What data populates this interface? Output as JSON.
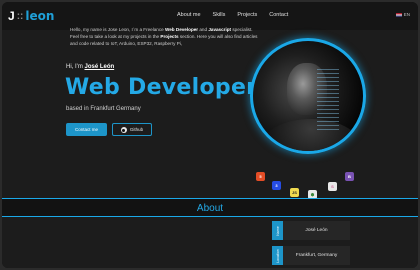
{
  "nav": {
    "logo_mark": "J",
    "logo_sep": "::",
    "logo_name": "leon",
    "links": [
      "About me",
      "Skills",
      "Projects",
      "Contact"
    ],
    "lang": "EN"
  },
  "hero": {
    "greeting_prefix": "Hi, I'm",
    "name": "José León",
    "title": "Web Developer",
    "location": "based in Frankfurt Germany",
    "contact_label": "Contact me",
    "github_label": "Github"
  },
  "tech_icons": [
    {
      "name": "html5-icon",
      "glyph": "5"
    },
    {
      "name": "css3-icon",
      "glyph": "3"
    },
    {
      "name": "javascript-icon",
      "glyph": "JS"
    },
    {
      "name": "nodejs-icon",
      "glyph": "⬢"
    },
    {
      "name": "sass-icon",
      "glyph": "S"
    },
    {
      "name": "bootstrap-icon",
      "glyph": "B"
    }
  ],
  "about": {
    "title": "About",
    "text_1": "Hello, my name is Jose Leon, I´m a Freelance",
    "bold_1": "Web Developer",
    "text_2": "and",
    "bold_2": "Javascript",
    "text_3": "specialist. Feel free to take a look at my projects in the",
    "bold_3": "Projects",
    "text_4": "section. Here you will also find articles and code related to IoT, Arduino, ESP32, Raspberry Pi,",
    "info": [
      {
        "tag": "Name",
        "value": "José León"
      },
      {
        "tag": "Location",
        "value": "Frankfurt, Germany"
      }
    ]
  },
  "colors": {
    "accent": "#24a9e6",
    "background": "#1c1c1c"
  }
}
